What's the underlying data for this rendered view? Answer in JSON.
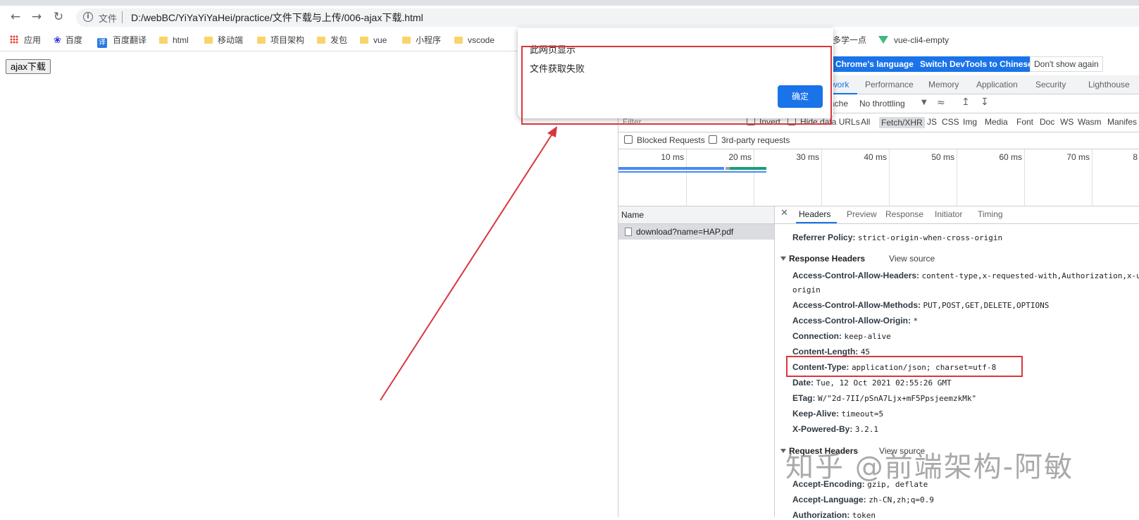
{
  "browser": {
    "back_icon": "arrow-left-icon",
    "forward_icon": "arrow-right-icon",
    "reload_icon": "reload-icon",
    "security_label": "文件",
    "url": "D:/webBC/YiYaYiYaHei/practice/文件下载与上传/006-ajax下载.html"
  },
  "bookmarks": [
    {
      "label": "应用",
      "icon": "apps-grid-icon"
    },
    {
      "label": "百度",
      "icon": "baidu-paw-icon"
    },
    {
      "label": "百度翻译",
      "icon": "translate-icon"
    },
    {
      "label": "html",
      "icon": "folder-icon"
    },
    {
      "label": "移动端",
      "icon": "folder-icon"
    },
    {
      "label": "项目架构",
      "icon": "folder-icon"
    },
    {
      "label": "发包",
      "icon": "folder-icon"
    },
    {
      "label": "vue",
      "icon": "folder-icon"
    },
    {
      "label": "小程序",
      "icon": "folder-icon"
    },
    {
      "label": "vscode",
      "icon": "folder-icon"
    },
    {
      "label": "多学一点",
      "icon": ""
    },
    {
      "label": "vue-cli4-empty",
      "icon": "vue-logo-icon"
    }
  ],
  "page": {
    "ajax_button": "ajax下载"
  },
  "alert": {
    "title": "此网页显示",
    "message": "文件获取失败",
    "ok": "确定"
  },
  "devtools": {
    "banner": {
      "match_language": "Chrome's language",
      "switch_chinese": "Switch DevTools to Chinese",
      "dont_show": "Don't show again"
    },
    "tabs": [
      "work",
      "Performance",
      "Memory",
      "Application",
      "Security",
      "Lighthouse"
    ],
    "network_toolbar": {
      "cache": "ache",
      "throttling": "No throttling"
    },
    "filter": {
      "label": "Filter",
      "invert": "Invert",
      "hide_data_urls": "Hide data URLs",
      "types": [
        "All",
        "Fetch/XHR",
        "JS",
        "CSS",
        "Img",
        "Media",
        "Font",
        "Doc",
        "WS",
        "Wasm",
        "Manifes"
      ]
    },
    "checks": {
      "blocked": "Blocked Requests",
      "third_party": "3rd-party requests"
    },
    "timeline_ticks": [
      "10 ms",
      "20 ms",
      "30 ms",
      "40 ms",
      "50 ms",
      "60 ms",
      "70 ms",
      "8"
    ],
    "name_header": "Name",
    "request_name": "download?name=HAP.pdf",
    "detail_tabs": [
      "Headers",
      "Preview",
      "Response",
      "Initiator",
      "Timing"
    ],
    "referrer": {
      "key": "Referrer Policy:",
      "value": "strict-origin-when-cross-origin"
    },
    "response_headers_title": "Response Headers",
    "view_source": "View source",
    "response_headers": [
      {
        "key": "Access-Control-Allow-Headers:",
        "value": "content-type,x-requested-with,Authorization,x-u",
        "cont": "origin"
      },
      {
        "key": "Access-Control-Allow-Methods:",
        "value": "PUT,POST,GET,DELETE,OPTIONS"
      },
      {
        "key": "Access-Control-Allow-Origin:",
        "value": "*"
      },
      {
        "key": "Connection:",
        "value": "keep-alive"
      },
      {
        "key": "Content-Length:",
        "value": "45"
      },
      {
        "key": "Content-Type:",
        "value": "application/json; charset=utf-8"
      },
      {
        "key": "Date:",
        "value": "Tue, 12 Oct 2021 02:55:26 GMT"
      },
      {
        "key": "ETag:",
        "value": "W/\"2d-7II/pSnA7Ljx+mF5PpsjeemzkMk\""
      },
      {
        "key": "Keep-Alive:",
        "value": "timeout=5"
      },
      {
        "key": "X-Powered-By:",
        "value": "3.2.1"
      }
    ],
    "request_headers_title": "Request Headers",
    "request_headers": [
      {
        "key": "Accept-Encoding:",
        "value": "gzip, deflate"
      },
      {
        "key": "Accept-Language:",
        "value": "zh-CN,zh;q=0.9"
      },
      {
        "key": "Authorization:",
        "value": "token"
      }
    ]
  },
  "watermark": "知乎 @前端架构-阿敏",
  "colors": {
    "accent": "#1a73e8",
    "highlight_box": "#d9363e"
  }
}
